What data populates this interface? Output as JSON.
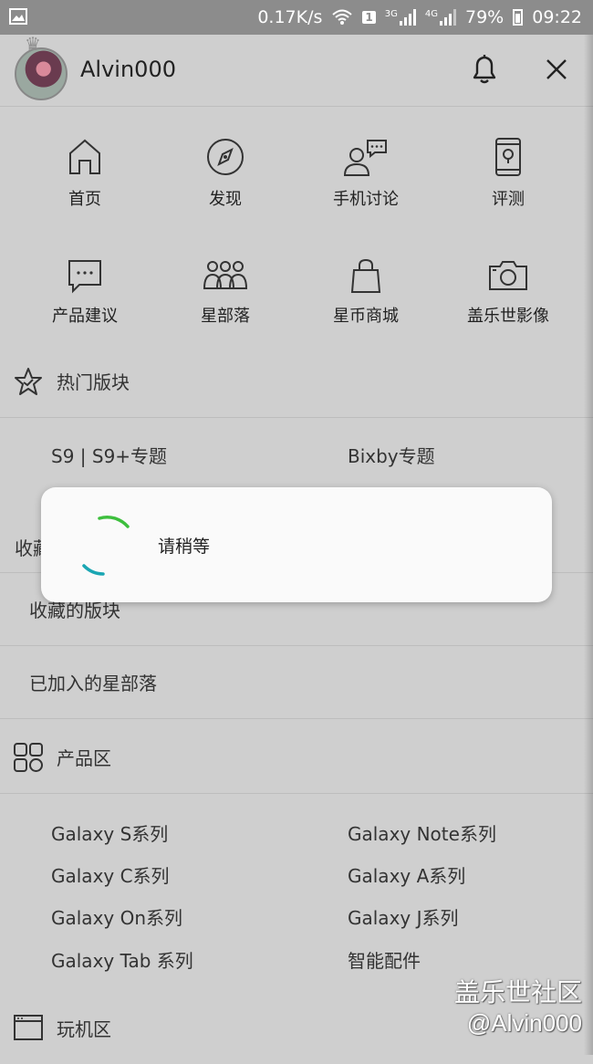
{
  "status_bar": {
    "speed": "0.17K/s",
    "sim": "1",
    "net1": "3G",
    "net2": "4G",
    "battery": "79%",
    "time": "09:22",
    "icons": [
      "image-icon",
      "wifi-icon",
      "signal-icon",
      "battery-icon"
    ]
  },
  "header": {
    "username": "Alvin000"
  },
  "nav_grid": [
    {
      "label": "首页",
      "icon": "home-icon"
    },
    {
      "label": "发现",
      "icon": "compass-icon"
    },
    {
      "label": "手机讨论",
      "icon": "discussion-icon"
    },
    {
      "label": "评测",
      "icon": "phone-review-icon"
    },
    {
      "label": "产品建议",
      "icon": "chat-dots-icon"
    },
    {
      "label": "星部落",
      "icon": "group-icon"
    },
    {
      "label": "星币商城",
      "icon": "shopping-bag-icon"
    },
    {
      "label": "盖乐世影像",
      "icon": "camera-icon"
    }
  ],
  "hot_section": {
    "title": "热门版块",
    "links": [
      "S9 | S9+专题",
      "Bixby专题"
    ],
    "partial_text": "收藏"
  },
  "favorites": {
    "boards": "收藏的版块",
    "tribes": "已加入的星部落"
  },
  "product_section": {
    "title": "产品区",
    "links": [
      "Galaxy S系列",
      "Galaxy Note系列",
      "Galaxy C系列",
      "Galaxy A系列",
      "Galaxy On系列",
      "Galaxy J系列",
      "Galaxy Tab 系列",
      "智能配件"
    ]
  },
  "play_section": {
    "title": "玩机区"
  },
  "dialog": {
    "message": "请稍等"
  },
  "watermark": {
    "line1": "盖乐世社区",
    "line2": "@Alvin000"
  },
  "colors": {
    "spinner_green": "#3dbf3d",
    "spinner_teal": "#1aa6b3",
    "dim_overlay": "#cfcfcf",
    "status_bar": "#8c8c8c"
  }
}
